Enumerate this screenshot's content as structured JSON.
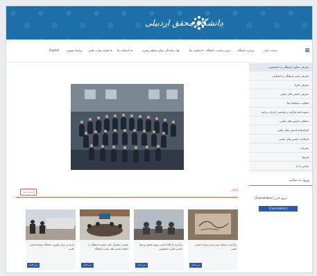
{
  "header": {
    "logo_text": "دانشگاه محقق اردبیلی"
  },
  "nav": {
    "menu_icon": "menu-icon",
    "items": [
      {
        "label": "صفحه اصلی",
        "active": true
      },
      {
        "label": "درباره دانشگاه"
      },
      {
        "label": "حوزه ریاست دانشگاه"
      },
      {
        "label": "معاونت ها ▾"
      },
      {
        "label": "نهاد نمایندگی مقام معظم رهبری"
      },
      {
        "label": "دانشکده ها ▾"
      },
      {
        "label": "اعضای هیات علمی ▾"
      },
      {
        "label": "روابط عمومی"
      },
      {
        "label": "English"
      }
    ]
  },
  "sidebar": {
    "items": [
      {
        "label": "معرفی معاون فرهنگی و دانشجویی"
      },
      {
        "label": "معرفی مدیر فرهنگی و اجتماعی"
      },
      {
        "label": "معرفی افراد"
      },
      {
        "label": "معرفی انجمن های علمی"
      },
      {
        "label": "فعالیت دانشکده ها"
      },
      {
        "label": "شیوه نامه فرآیند درخواست اجرای برنامه"
      },
      {
        "label": "عملکرد انجمن های علمی"
      },
      {
        "label": "اساسنامه انجمن های علمی"
      },
      {
        "label": "انتخابات انجمن های علمی"
      },
      {
        "label": "نشریات"
      },
      {
        "label": "فرمها"
      },
      {
        "label": "تماس با ما"
      }
    ]
  },
  "login": {
    "title": "ورود به سایت",
    "line": "[Cancelation] خروج کاربر",
    "button": "[Cancelation]"
  },
  "news": {
    "title": "اخبار",
    "archive": "آرشیو اخبار",
    "more_label": "متن کامل",
    "cards": [
      {
        "caption": "برگزاری مسابقه دوم شدن مربیان انجمن علمی"
      },
      {
        "caption": "برگزاری کارگاه آشنایی روش تحقیق توسط انجمن علمی دانشجویی"
      },
      {
        "caption": "نشست مشترک دفتر معاونت فرهنگی با اعضای انجمن های علمی دانشگاه"
      },
      {
        "caption": "بازدید از مرکز نوآوری دانشگاه توسط انجمن علمی"
      }
    ]
  },
  "colors": {
    "banner": "#1d6fa8",
    "accent": "#d65c5c",
    "button": "#2d58a6"
  }
}
